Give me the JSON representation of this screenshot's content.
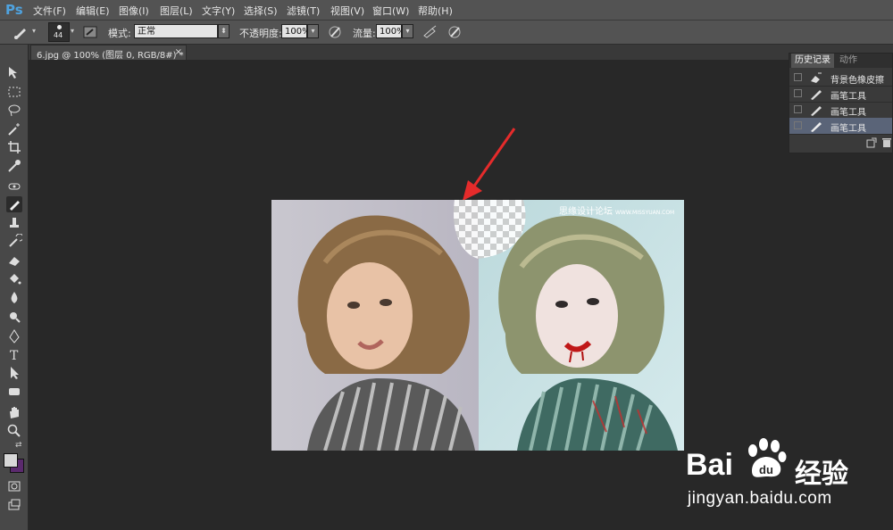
{
  "app": {
    "logo": "Ps"
  },
  "menu": [
    "文件(F)",
    "编辑(E)",
    "图像(I)",
    "图层(L)",
    "文字(Y)",
    "选择(S)",
    "滤镜(T)",
    "视图(V)",
    "窗口(W)",
    "帮助(H)"
  ],
  "options": {
    "brush_size": "44",
    "mode_label": "模式:",
    "mode_value": "正常",
    "opacity_label": "不透明度:",
    "opacity_value": "100%",
    "flow_label": "流量:",
    "flow_value": "100%"
  },
  "document_tab": {
    "title": "6.jpg @ 100% (图层 0, RGB/8#) *",
    "close": "×"
  },
  "canvas": {
    "watermark_cn": "思缘设计论坛",
    "watermark_url": "WWW.MISSYUAN.COM"
  },
  "history_panel": {
    "tabs": [
      "历史记录",
      "动作"
    ],
    "items": [
      {
        "label": "背景色橡皮擦",
        "icon": "background-eraser-icon",
        "selected": false
      },
      {
        "label": "画笔工具",
        "icon": "brush-icon",
        "selected": false
      },
      {
        "label": "画笔工具",
        "icon": "brush-icon",
        "selected": false
      },
      {
        "label": "画笔工具",
        "icon": "brush-icon",
        "selected": true
      }
    ]
  },
  "colors": {
    "foreground": "#d8d8d8",
    "background": "#5b2a6e",
    "accent_arrow": "#e52b2b",
    "selected_row": "#5a6478"
  },
  "watermark": {
    "brand": "Bai",
    "brand2": "经验",
    "url": "jingyan.baidu.com"
  }
}
